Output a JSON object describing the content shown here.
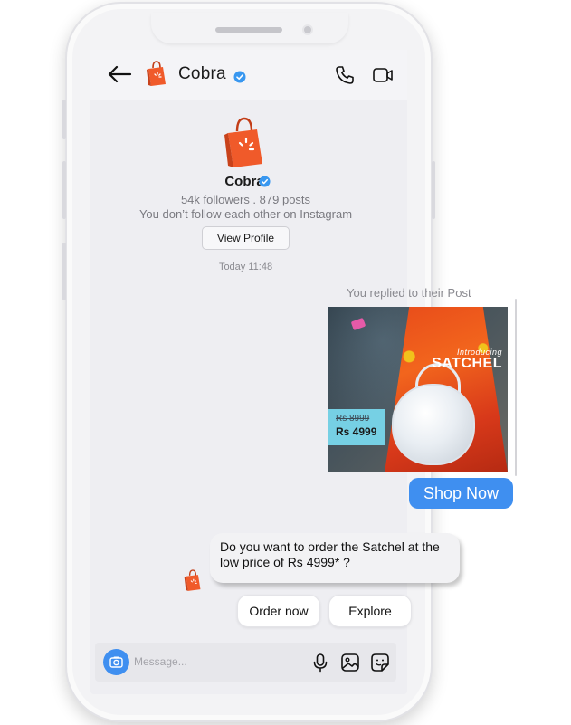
{
  "header": {
    "name": "Cobra"
  },
  "profile": {
    "name": "Cobra",
    "stats": "54k followers . 879 posts",
    "follow_note": "You don’t follow each other on Instagram",
    "view_profile_label": "View Profile"
  },
  "thread": {
    "timestamp": "Today 11:48",
    "replied_note": "You replied to their Post",
    "post": {
      "intro": "Introducing",
      "title": "SATCHEL",
      "old_price": "Rs 8999",
      "new_price": "Rs 4999"
    },
    "shop_now_label": "Shop Now",
    "bot_message": "Do you want to order the Satchel at the low price of Rs 4999* ?",
    "quick_replies": [
      "Order now",
      "Explore"
    ]
  },
  "composer": {
    "placeholder": "Message..."
  },
  "colors": {
    "accent_blue": "#3f8ff0",
    "brand_orange": "#f05a2a",
    "price_tag": "#76d0e4"
  },
  "icons": [
    "back-arrow-icon",
    "brand-logo-icon",
    "verified-badge-icon",
    "phone-call-icon",
    "video-call-icon",
    "camera-icon",
    "microphone-icon",
    "gallery-icon",
    "sticker-icon"
  ]
}
